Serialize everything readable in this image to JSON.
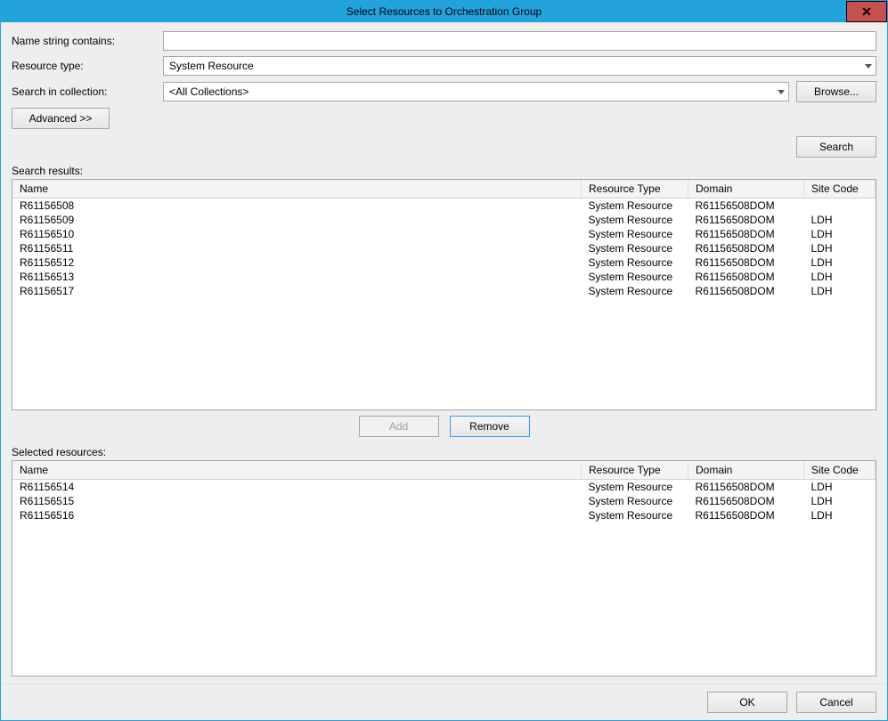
{
  "window": {
    "title": "Select Resources to Orchestration Group",
    "close_icon": "✕"
  },
  "form": {
    "name_label": "Name string contains:",
    "name_value": "",
    "type_label": "Resource type:",
    "type_value": "System Resource",
    "collection_label": "Search in collection:",
    "collection_value": "<All Collections>",
    "browse_label": "Browse...",
    "advanced_label": "Advanced >>",
    "search_label": "Search"
  },
  "results": {
    "section_label": "Search results:",
    "columns": {
      "name": "Name",
      "rtype": "Resource Type",
      "domain": "Domain",
      "site": "Site Code"
    },
    "rows": [
      {
        "name": "R61156508",
        "rtype": "System Resource",
        "domain": "R61156508DOM",
        "site": ""
      },
      {
        "name": "R61156509",
        "rtype": "System Resource",
        "domain": "R61156508DOM",
        "site": "LDH"
      },
      {
        "name": "R61156510",
        "rtype": "System Resource",
        "domain": "R61156508DOM",
        "site": "LDH"
      },
      {
        "name": "R61156511",
        "rtype": "System Resource",
        "domain": "R61156508DOM",
        "site": "LDH"
      },
      {
        "name": "R61156512",
        "rtype": "System Resource",
        "domain": "R61156508DOM",
        "site": "LDH"
      },
      {
        "name": "R61156513",
        "rtype": "System Resource",
        "domain": "R61156508DOM",
        "site": "LDH"
      },
      {
        "name": "R61156517",
        "rtype": "System Resource",
        "domain": "R61156508DOM",
        "site": "LDH"
      }
    ]
  },
  "mid": {
    "add_label": "Add",
    "remove_label": "Remove"
  },
  "selected": {
    "section_label": "Selected resources:",
    "columns": {
      "name": "Name",
      "rtype": "Resource Type",
      "domain": "Domain",
      "site": "Site Code"
    },
    "rows": [
      {
        "name": "R61156514",
        "rtype": "System Resource",
        "domain": "R61156508DOM",
        "site": "LDH"
      },
      {
        "name": "R61156515",
        "rtype": "System Resource",
        "domain": "R61156508DOM",
        "site": "LDH"
      },
      {
        "name": "R61156516",
        "rtype": "System Resource",
        "domain": "R61156508DOM",
        "site": "LDH"
      }
    ]
  },
  "footer": {
    "ok_label": "OK",
    "cancel_label": "Cancel"
  }
}
